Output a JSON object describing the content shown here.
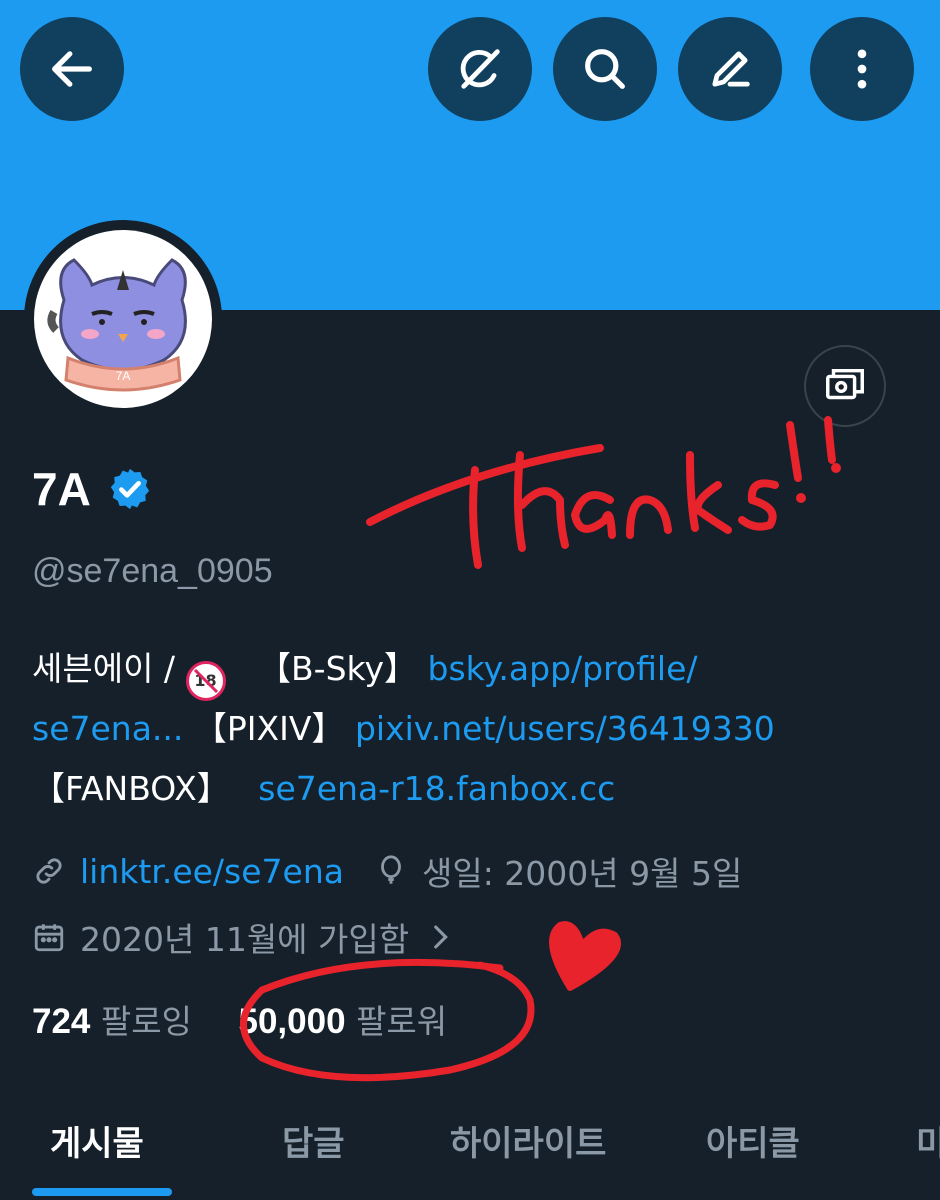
{
  "profile": {
    "name": "7A",
    "handle": "@se7ena_0905",
    "avatar_text": "7A"
  },
  "bio": {
    "line1_prefix": "세븐에이 / ",
    "line1_badge": "18",
    "line1_mid": "【B-Sky】",
    "line1_link": "bsky.app/profile/",
    "line2_link1": "se7ena...",
    "line2_mid": "【PIXIV】",
    "line2_link2": "pixiv.net/users/36419330",
    "line3_label": "【FANBOX】",
    "line3_link": "se7ena-r18.fanbox.cc"
  },
  "meta": {
    "website": "linktr.ee/se7ena",
    "birthday": "생일: 2000년 9월 5일",
    "joined": "2020년 11월에 가입함"
  },
  "stats": {
    "following_count": "724",
    "following_label": "팔로잉",
    "followers_count": "50,000",
    "followers_label": "팔로워"
  },
  "tabs": [
    "게시물",
    "답글",
    "하이라이트",
    "아티클",
    "미"
  ],
  "annotation": {
    "text": "Thanks!!"
  },
  "icons": {
    "back": "back-arrow-icon",
    "grok": "grok-icon",
    "search": "search-icon",
    "edit": "edit-icon",
    "more": "more-vertical-icon",
    "card": "subscription-card-icon",
    "verified": "verified-badge-icon",
    "link": "link-icon",
    "birthday": "balloon-icon",
    "calendar": "calendar-icon"
  },
  "colors": {
    "banner": "#1d9bf0",
    "background": "#15202b",
    "accent": "#1d9bf0",
    "annotation": "#e8232b"
  }
}
